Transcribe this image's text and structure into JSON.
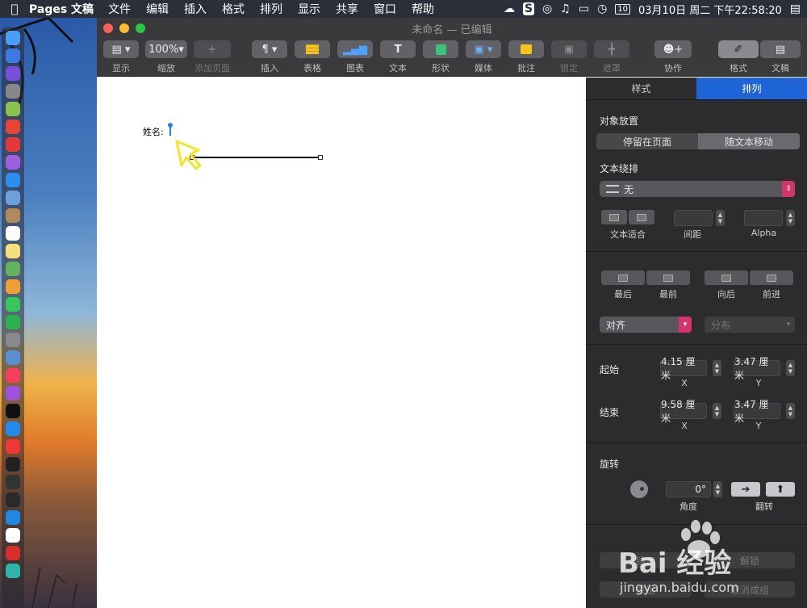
{
  "menubar": {
    "app_name": "Pages 文稿",
    "menus": [
      "文件",
      "编辑",
      "插入",
      "格式",
      "排列",
      "显示",
      "共享",
      "窗口",
      "帮助"
    ],
    "clock": "03月10日 周二 下午22:58:20",
    "calendar_badge": "10"
  },
  "window": {
    "title": "未命名 — 已编辑"
  },
  "toolbar": {
    "view_label": "显示",
    "zoom_value": "100%",
    "zoom_label": "缩放",
    "add_page_label": "添加页面",
    "insert_label": "插入",
    "table_label": "表格",
    "chart_label": "图表",
    "text_label": "文本",
    "shape_label": "形状",
    "media_label": "媒体",
    "comment_label": "批注",
    "lock_label": "锁定",
    "mask_label": "遮罩",
    "collab_label": "协作",
    "format_label": "格式",
    "document_label": "文稿"
  },
  "document": {
    "name_label": "姓名:"
  },
  "inspector": {
    "tabs": [
      "样式",
      "排列"
    ],
    "active_tab": "排列",
    "placement": {
      "title": "对象放置",
      "options": [
        "停留在页面",
        "随文本移动"
      ],
      "selected": "随文本移动"
    },
    "wrap": {
      "title": "文本绕排",
      "value": "无",
      "fit_label": "文本适合",
      "spacing_label": "间距",
      "alpha_label": "Alpha"
    },
    "layer": {
      "back_label": "最后",
      "front_label": "最前",
      "backward_label": "向后",
      "forward_label": "前进"
    },
    "align": {
      "align_value": "对齐",
      "distribute_value": "分布"
    },
    "start": {
      "title": "起始",
      "x": "4.15 厘米",
      "y": "3.47 厘米",
      "x_label": "X",
      "y_label": "Y"
    },
    "end": {
      "title": "结束",
      "x": "9.58 厘米",
      "y": "3.47 厘米",
      "x_label": "X",
      "y_label": "Y"
    },
    "rotate": {
      "title": "旋转",
      "angle": "0°",
      "angle_label": "角度",
      "flip_label": "翻转"
    },
    "lock_label": "锁定",
    "unlock_label": "解锁",
    "group_label": "成组",
    "ungroup_label": "取消成组"
  },
  "watermark": {
    "brand": "Bai 经验",
    "url": "jingyan.baidu.com"
  },
  "colors": {
    "accent": "#1f64d6",
    "align_popup": "#d6336c",
    "pointer": "#f5e623"
  }
}
